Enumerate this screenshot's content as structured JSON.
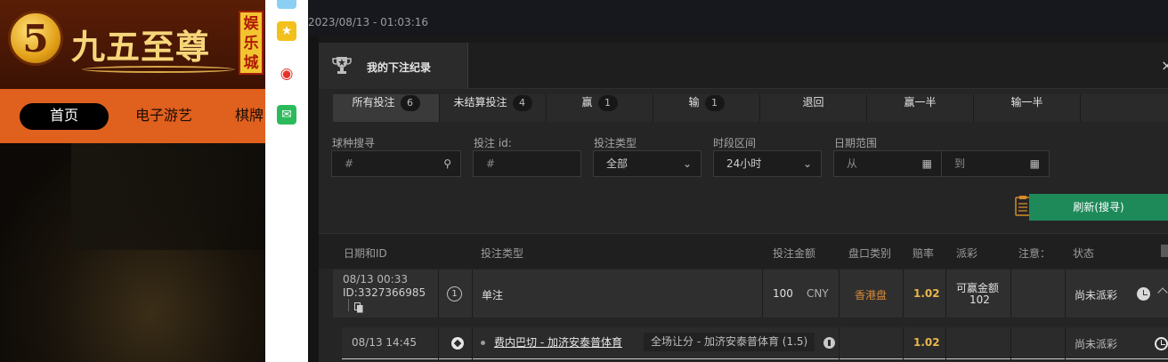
{
  "site": {
    "logo_digit": "5",
    "logo_text": "九五至尊",
    "logo_badge": "娱乐城",
    "nav": [
      "首页",
      "电子游艺",
      "棋牌"
    ]
  },
  "app": {
    "datetime": "2023/08/13 - 01:03:16",
    "modal_title": "我的下注纪录",
    "tabs": [
      {
        "label": "所有投注",
        "count": "6"
      },
      {
        "label": "未结算投注",
        "count": "4"
      },
      {
        "label": "赢",
        "count": "1"
      },
      {
        "label": "输",
        "count": "1"
      },
      {
        "label": "退回",
        "count": ""
      },
      {
        "label": "赢一半",
        "count": ""
      },
      {
        "label": "输一半",
        "count": ""
      }
    ],
    "filters": {
      "sport_label": "球种搜寻",
      "sport_placeholder": "#",
      "betid_label": "投注 id:",
      "betid_placeholder": "#",
      "bettype_label": "投注类型",
      "bettype_value": "全部",
      "period_label": "时段区间",
      "period_value": "24小时",
      "daterange_label": "日期范围",
      "date_from": "从",
      "date_to": "到"
    },
    "refresh_label": "刷新(搜寻)",
    "columns": [
      "日期和ID",
      "投注类型",
      "投注金额",
      "盘口类别",
      "赔率",
      "派彩",
      "注意：",
      "状态"
    ],
    "row1": {
      "date": "08/13 00:33",
      "id": "ID:3327366985",
      "leg_count": "1",
      "type": "单注",
      "amount": "100",
      "currency": "CNY",
      "odds_type": "香港盘",
      "odds": "1.02",
      "payout_label": "可赢金额",
      "payout": "102",
      "status": "尚未派彩"
    },
    "row2": {
      "date": "08/13 14:45",
      "match": "费内巴切 - 加济安泰普体育",
      "market": "全场让分 - 加济安泰普体育 (1.5)",
      "odds": "1.02",
      "status": "尚未派彩"
    },
    "colors": {
      "accent_green": "#1e8a5a",
      "odds_gold": "#e8b64a",
      "odds_type_orange": "#d98b3a",
      "nav_orange": "#e0601e"
    }
  }
}
